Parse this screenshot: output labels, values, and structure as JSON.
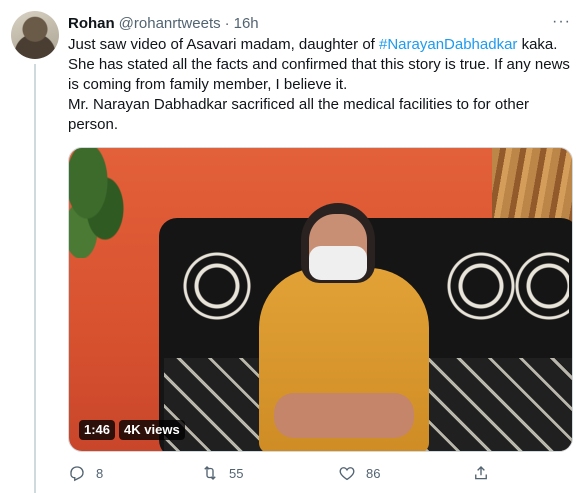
{
  "tweet": {
    "author_name": "Rohan",
    "author_handle": "@rohanrtweets",
    "separator": "·",
    "time": "16h",
    "more": "···",
    "text_line1_before": "Just saw video of Asavari madam, daughter of ",
    "hashtag": "#NarayanDabhadkar",
    "text_line1_after": " kaka. She has stated all the facts and confirmed that this story is true. If any news is coming from family member, I believe it.",
    "text_line2": "Mr. Narayan Dabhadkar sacrificed all the medical facilities to for other person."
  },
  "video": {
    "duration": "1:46",
    "views": "4K views"
  },
  "actions": {
    "reply_icon": "reply-icon",
    "replies": "8",
    "retweet_icon": "retweet-icon",
    "retweets": "55",
    "like_icon": "like-icon",
    "likes": "86",
    "share_icon": "share-icon"
  },
  "colors": {
    "accent": "#1d9bf0",
    "secondary_text": "#536471",
    "text": "#0f1419"
  }
}
